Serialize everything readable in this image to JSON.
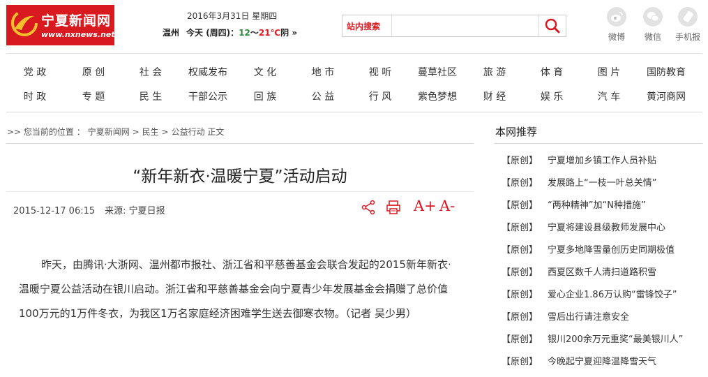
{
  "logo": {
    "name": "宁夏新闻网",
    "domain": "www.nxnews.net"
  },
  "date": "2016年3月31日 星期四",
  "weather": {
    "city": "温州",
    "today": "今天 (周四)：",
    "low": "12",
    "tilde": "～",
    "high": "21",
    "unit": "℃",
    "cond": "阴",
    "more": "»"
  },
  "search": {
    "label": "站内搜索",
    "placeholder": "",
    "icon": "search-icon"
  },
  "social": [
    {
      "label": "微博",
      "icon": "weibo-icon"
    },
    {
      "label": "微信",
      "icon": "wechat-icon"
    },
    {
      "label": "手机报",
      "icon": "mobile-icon"
    }
  ],
  "nav": {
    "row1": [
      "党 政",
      "原 创",
      "社 会",
      "权威发布",
      "文 化",
      "地 市",
      "视 听",
      "蔓草社区",
      "旅 游",
      "体 育",
      "图 片",
      "国防教育"
    ],
    "row2": [
      "时 政",
      "专 题",
      "民 生",
      "干部公示",
      "回 族",
      "公 益",
      "行 风",
      "紫色梦想",
      "财 经",
      "娱 乐",
      "汽 车",
      "黄河商网"
    ]
  },
  "breadcrumb": {
    "prefix": ">> 您当前的位置 ：",
    "items": [
      "宁夏新闻网",
      ">",
      "民生",
      ">",
      "公益行动",
      "正文"
    ]
  },
  "article": {
    "title": "“新年新衣·温暖宁夏”活动启动",
    "datetime": "2015-12-17 06:15",
    "source": "来源: 宁夏日报",
    "tools": {
      "share": "share-icon",
      "print": "print-icon",
      "font_up": "A+",
      "font_down": "A-"
    },
    "body": "昨天，由腾讯·大浙网、温州都市报社、浙江省和平慈善基金会联合发起的2015新年新衣·温暖宁夏公益活动在银川启动。浙江省和平慈善基金会向宁夏青少年发展基金会捐赠了总价值100万元的1万件冬衣，为我区1万名家庭经济困难学生送去御寒衣物。（记者 吴少男）"
  },
  "sidebar": {
    "title": "本网推荐",
    "items": [
      {
        "tag": "【原创】",
        "text": "宁夏增加乡镇工作人员补贴"
      },
      {
        "tag": "【原创】",
        "text": "发展路上“一枝一叶总关情”"
      },
      {
        "tag": "【原创】",
        "text": "“两种精神”加“N种措施”"
      },
      {
        "tag": "【原创】",
        "text": "宁夏将建设县级教师发展中心"
      },
      {
        "tag": "【原创】",
        "text": "宁夏多地降雪量创历史同期极值"
      },
      {
        "tag": "【原创】",
        "text": "西夏区数千人清扫道路积雪"
      },
      {
        "tag": "【原创】",
        "text": "爱心企业1.86万认购“雷锋饺子”"
      },
      {
        "tag": "【原创】",
        "text": "雪后出行请注意安全"
      },
      {
        "tag": "【原创】",
        "text": "银川200余万元重奖“最美银川人”"
      },
      {
        "tag": "【原创】",
        "text": "今晚起宁夏迎降温降雪天气"
      }
    ]
  },
  "colors": {
    "brand": "#d8191f",
    "temp_low": "#2e8b3a",
    "temp_high": "#d8191f"
  }
}
